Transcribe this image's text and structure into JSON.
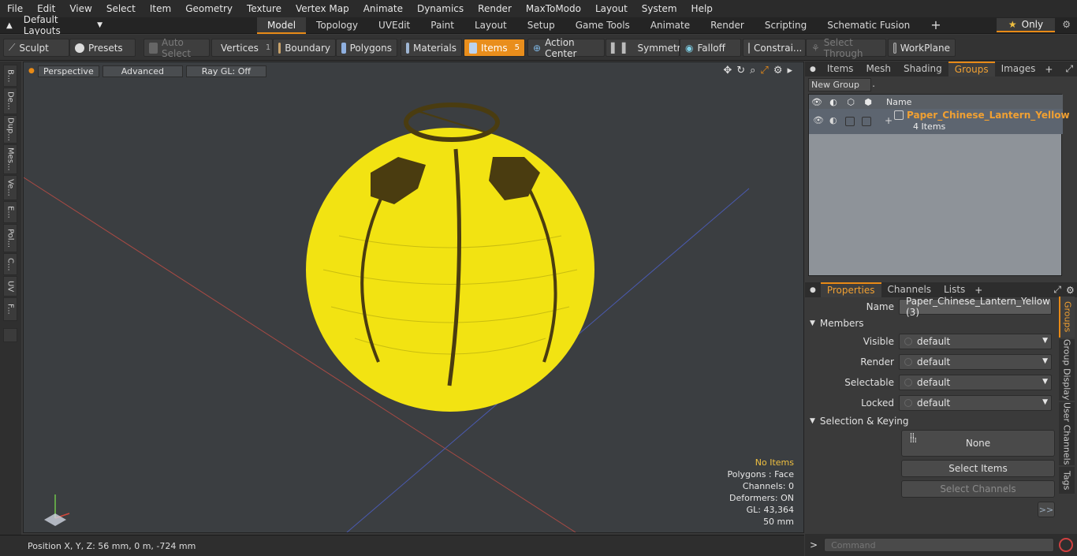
{
  "menu": [
    "File",
    "Edit",
    "View",
    "Select",
    "Item",
    "Geometry",
    "Texture",
    "Vertex Map",
    "Animate",
    "Dynamics",
    "Render",
    "MaxToModo",
    "Layout",
    "System",
    "Help"
  ],
  "layouts": {
    "label": "Default Layouts"
  },
  "mode_tabs": [
    "Model",
    "Topology",
    "UVEdit",
    "Paint",
    "Layout",
    "Setup",
    "Game Tools",
    "Animate",
    "Render",
    "Scripting",
    "Schematic Fusion"
  ],
  "only_label": "Only",
  "toolbar": {
    "sculpt": "Sculpt",
    "presets": "Presets",
    "auto_select": "Auto Select",
    "vertices": "Vertices",
    "vertices_count": "1",
    "boundary": "Boundary",
    "polygons": "Polygons",
    "materials": "Materials",
    "items": "Items",
    "items_count": "5",
    "action_center": "Action Center",
    "symmetry": "Symmetry",
    "falloff": "Falloff",
    "constraints": "Constrai...",
    "select_through": "Select Through",
    "workplane": "WorkPlane"
  },
  "left_tabs": [
    "B...",
    "De...",
    "Dup...",
    "Mes...",
    "Ve...",
    "E...",
    "Pol...",
    "C...",
    "UV",
    "F..."
  ],
  "viewport": {
    "perspective": "Perspective",
    "advanced": "Advanced",
    "raygl": "Ray GL: Off",
    "stats": {
      "items": "No Items",
      "polygons": "Polygons : Face",
      "channels": "Channels: 0",
      "deformers": "Deformers: ON",
      "gl": "GL: 43,364",
      "scale": "50 mm"
    }
  },
  "status": {
    "position": "Position X, Y, Z:  56 mm, 0 m, -724 mm"
  },
  "top_panel": {
    "tabs": [
      "Items",
      "Mesh ...",
      "Shading",
      "Groups",
      "Images"
    ],
    "new_group": "New Group",
    "col_name": "Name",
    "group_name": "Paper_Chinese_Lantern_Yellow",
    "group_items": "4 Items"
  },
  "props_panel": {
    "tabs": [
      "Properties",
      "Channels",
      "Lists"
    ],
    "name_label": "Name",
    "name_value": "Paper_Chinese_Lantern_Yellow (3)",
    "members": "Members",
    "visible_label": "Visible",
    "render_label": "Render",
    "selectable_label": "Selectable",
    "locked_label": "Locked",
    "default": "default",
    "sel_keying": "Selection & Keying",
    "none": "None",
    "select_items": "Select Items",
    "select_channels": "Select Channels",
    "more": ">>"
  },
  "side_tabs": [
    "Groups",
    "Group Display",
    "User Channels",
    "Tags"
  ],
  "command": {
    "placeholder": "Command",
    "prompt": ">"
  },
  "colors": {
    "accent": "#e88a16",
    "lantern": "#f2e312",
    "group_text": "#f0a032"
  }
}
